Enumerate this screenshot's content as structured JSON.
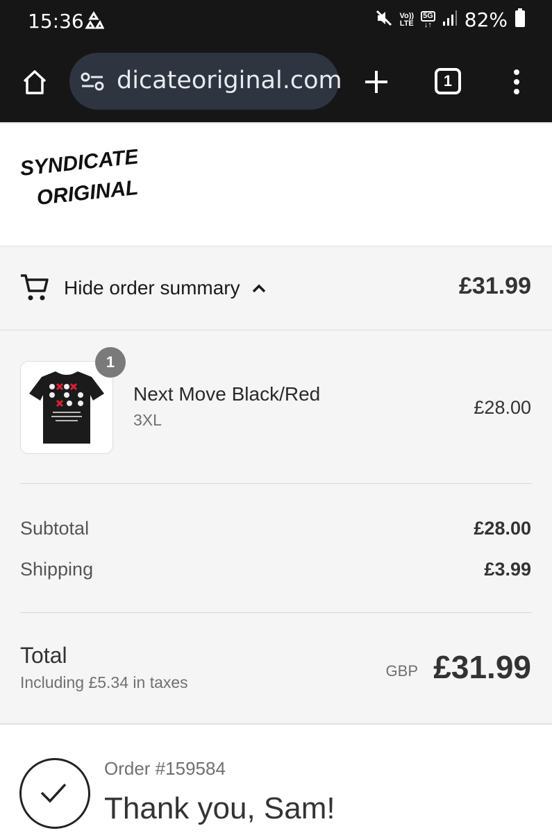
{
  "status_bar": {
    "time": "15:36",
    "volte_top": "Vo))",
    "volte_bottom": "LTE",
    "network": "5G",
    "battery": "82%",
    "icons": [
      "recycle-icon",
      "mute-icon",
      "signal-icon",
      "battery-icon"
    ]
  },
  "browser": {
    "url": "dicateoriginal.com",
    "tab_count": "1",
    "icons": [
      "home-icon",
      "site-settings-icon",
      "new-tab-icon",
      "tabs-icon",
      "menu-icon"
    ]
  },
  "store": {
    "logo_text": "SYNDICATE ORIGINAL"
  },
  "summary_toggle": {
    "label": "Hide order summary",
    "total": "£31.99"
  },
  "line_item": {
    "quantity": "1",
    "name": "Next Move Black/Red",
    "variant": "3XL",
    "price": "£28.00"
  },
  "costs": {
    "subtotal_label": "Subtotal",
    "subtotal_value": "£28.00",
    "shipping_label": "Shipping",
    "shipping_value": "£3.99",
    "total_label": "Total",
    "tax_note": "Including £5.34 in taxes",
    "currency": "GBP",
    "total_value": "£31.99"
  },
  "confirmation": {
    "order_number": "Order #159584",
    "thanks": "Thank you, Sam!"
  },
  "colors": {
    "chrome": "#161616",
    "url_pill": "#2e3440",
    "panel": "#f5f5f5"
  }
}
